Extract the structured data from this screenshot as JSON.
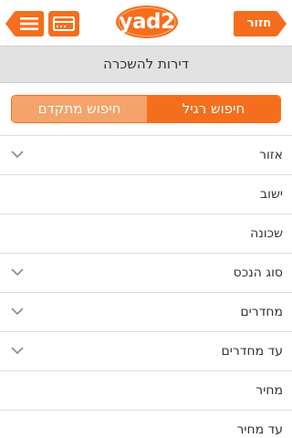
{
  "header": {
    "back_label": "חזור",
    "logo_text": "yad2",
    "brand_color": "#f46e1d"
  },
  "page": {
    "title": "דירות להשכרה"
  },
  "tabs": [
    {
      "label": "חיפוש רגיל",
      "active": true
    },
    {
      "label": "חיפוש מתקדם",
      "active": false
    }
  ],
  "fields": [
    {
      "label": "אזור",
      "dropdown": true
    },
    {
      "label": "ישוב",
      "dropdown": false
    },
    {
      "label": "שכונה",
      "dropdown": false
    },
    {
      "label": "סוג הנכס",
      "dropdown": true
    },
    {
      "label": "מחדרים",
      "dropdown": true
    },
    {
      "label": "עד מחדרים",
      "dropdown": true
    },
    {
      "label": "מחיר",
      "dropdown": false
    },
    {
      "label": "עד מחיר",
      "dropdown": false
    }
  ],
  "icons": {
    "menu": "menu-icon",
    "card": "credit-card-icon",
    "dropdown": "chevron-down-icon"
  }
}
